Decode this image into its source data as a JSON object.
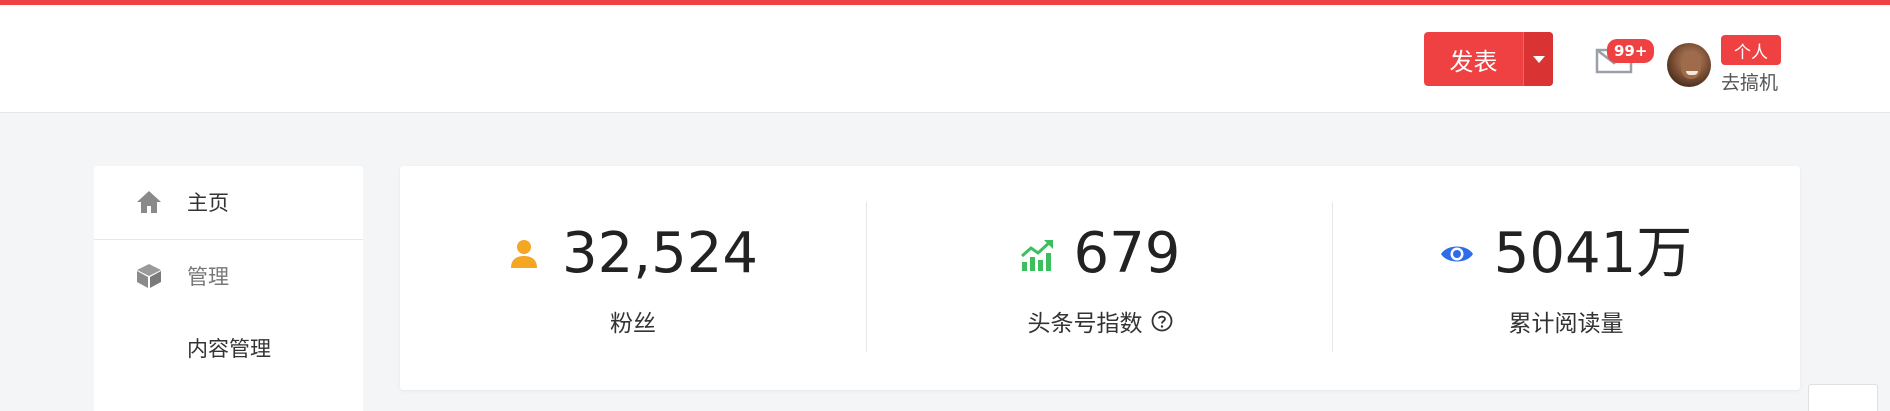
{
  "header": {
    "publish_label": "发表",
    "notifications_badge": "99+",
    "personal_tag": "个人",
    "username": "去搞机"
  },
  "sidebar": {
    "items": [
      {
        "label": "主页",
        "icon": "home-icon"
      },
      {
        "label": "管理",
        "icon": "cube-icon"
      },
      {
        "label": "内容管理",
        "icon": ""
      }
    ]
  },
  "stats": [
    {
      "value": "32,524",
      "label": "粉丝",
      "icon": "user-icon",
      "color": "#f5a623"
    },
    {
      "value": "679",
      "label": "头条号指数",
      "icon": "trend-up-chart-icon",
      "color": "#3cbf5c"
    },
    {
      "value": "5041万",
      "label": "累计阅读量",
      "icon": "eye-icon",
      "color": "#2f6de8"
    }
  ],
  "colors": {
    "accent": "#f04142",
    "background": "#f4f5f6"
  }
}
